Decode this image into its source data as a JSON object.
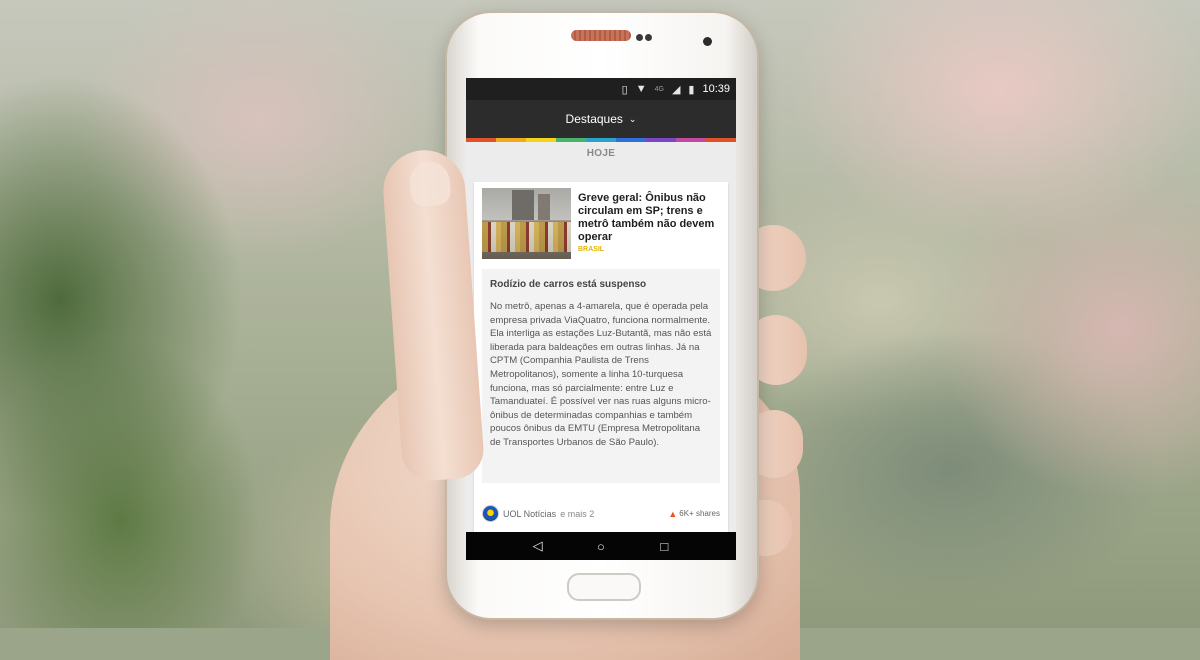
{
  "status_bar": {
    "network": "4G",
    "time": "10:39",
    "icons": [
      "vibrate-icon",
      "wifi-icon",
      "signal-icon",
      "battery-icon"
    ]
  },
  "app_bar": {
    "title": "Destaques",
    "dropdown_icon": "chevron-down-icon"
  },
  "category_colors": [
    "#e1522b",
    "#f2a91b",
    "#f6d31a",
    "#49b36a",
    "#2aa3c8",
    "#2f6fd8",
    "#7a48c7",
    "#c24aa0",
    "#e1522b"
  ],
  "feed": {
    "day_label": "HOJE",
    "article": {
      "headline": "Greve geral: Ônibus não circulam em SP; trens e metrô também não devem operar",
      "category": "BRASIL",
      "summary_title": "Rodízio de carros está suspenso",
      "summary_body": "No metrô, apenas a 4-amarela, que é operada pela empresa privada ViaQuatro, funciona normalmente. Ela interliga as estações Luz-Butantã, mas não está liberada para baldeações em outras linhas. Já na CPTM (Companhia Paulista de Trens Metropolitanos), somente a linha 10-turquesa funciona, mas só parcialmente: entre Luz e Tamanduateí. É possível ver nas ruas alguns micro-ônibus de determinadas companhias e também poucos ônibus da EMTU (Empresa Metropolitana de Transportes Urbanos de São Paulo).",
      "source": "UOL Notícias",
      "source_more": "e mais 2",
      "shares": "6K+ shares"
    }
  },
  "nav_bar": {
    "back_icon": "◁",
    "home_icon": "○",
    "recents_icon": "□"
  }
}
